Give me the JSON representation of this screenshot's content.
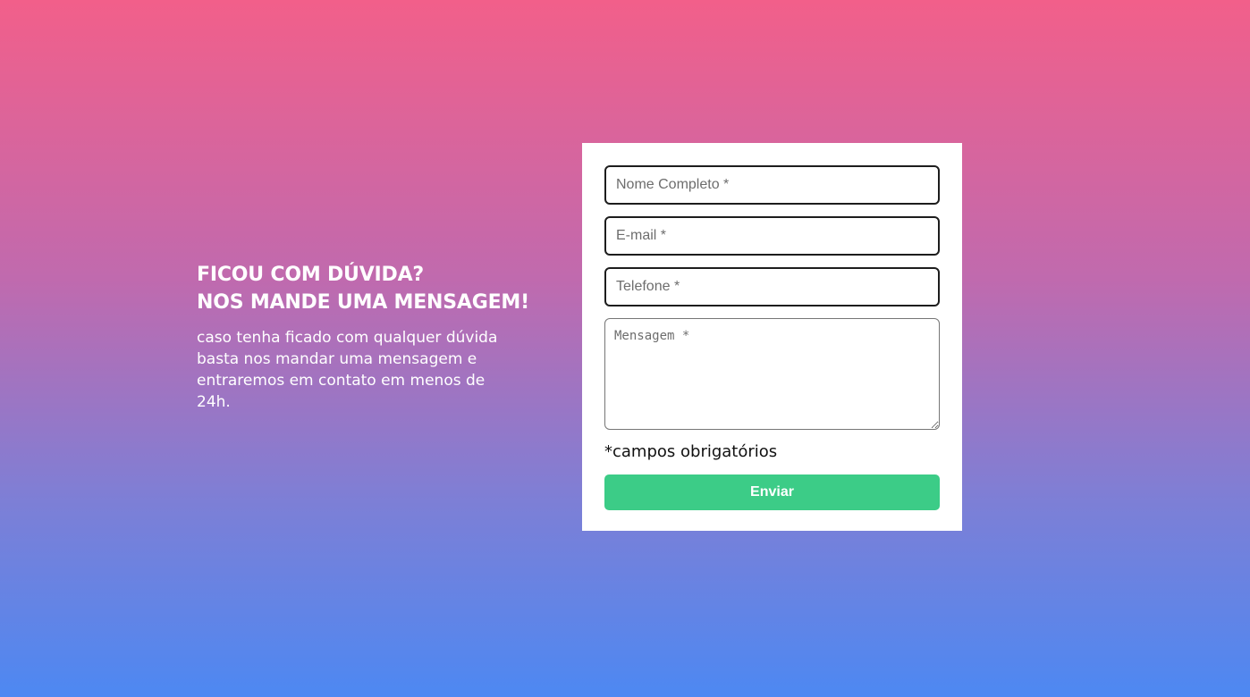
{
  "intro": {
    "title_line1": "FICOU COM DÚVIDA?",
    "title_line2": "NOS MANDE UMA MENSAGEM!",
    "description": "caso tenha ficado com qualquer dúvida basta nos mandar uma mensagem e entraremos em contato em menos de 24h."
  },
  "form": {
    "name": {
      "placeholder": "Nome Completo *",
      "value": ""
    },
    "email": {
      "placeholder": "E-mail *",
      "value": ""
    },
    "phone": {
      "placeholder": "Telefone *",
      "value": ""
    },
    "message": {
      "placeholder": "Mensagem *",
      "value": ""
    },
    "required_note": "*campos obrigatórios",
    "submit_label": "Enviar"
  },
  "colors": {
    "gradient_top": "#f25f8a",
    "gradient_bottom": "#4d88f2",
    "submit_button": "#3ccc87"
  }
}
